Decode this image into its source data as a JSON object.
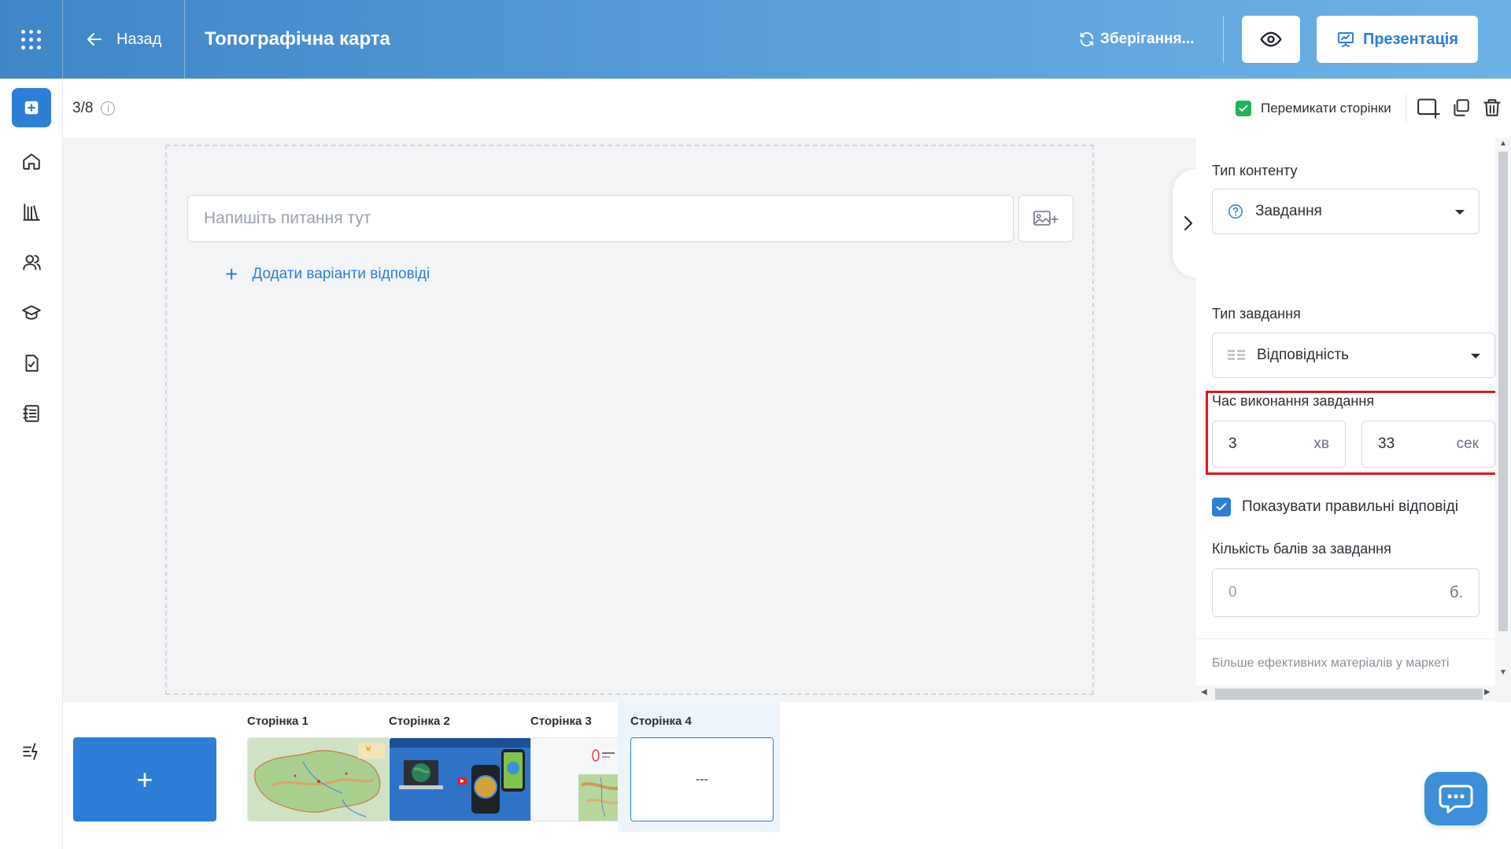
{
  "header": {
    "back_label": "Назад",
    "title": "Топографічна карта",
    "saving_label": "Зберігання...",
    "present_label": "Презентація"
  },
  "subbar": {
    "page_counter": "3/8",
    "switch_pages_label": "Перемикати сторінки",
    "switch_pages_checked": true
  },
  "editor": {
    "question_placeholder": "Напишіть питання тут",
    "question_value": "",
    "add_answers_label": "Додати варіанти відповіді"
  },
  "panel": {
    "content_type_label": "Тип контенту",
    "content_type_value": "Завдання",
    "task_type_label": "Тип завдання",
    "task_type_value": "Відповідність",
    "time_label": "Час виконання завдання",
    "minutes_value": "3",
    "minutes_unit": "хв",
    "seconds_value": "33",
    "seconds_unit": "сек",
    "show_correct_label": "Показувати правильні відповіді",
    "show_correct_checked": true,
    "score_label": "Кількість балів за завдання",
    "score_placeholder": "0",
    "score_unit": "б.",
    "market_link": "Більше ефективних матеріалів у маркеті"
  },
  "pages": {
    "add_label": "+",
    "items": [
      {
        "label": "Сторінка 1"
      },
      {
        "label": "Сторінка 2"
      },
      {
        "label": "Сторінка 3"
      },
      {
        "label": "Сторінка 4",
        "content": "---"
      }
    ],
    "active_index": 3
  },
  "colors": {
    "accent": "#2d7ed6",
    "header_gradient_start": "#3f86c9",
    "header_gradient_end": "#6cb2e6",
    "highlight_frame": "#e3141c",
    "check_green": "#21b35b"
  },
  "icons": {
    "apps": "apps-grid-icon",
    "back": "arrow-left-icon",
    "saving": "refresh-icon",
    "preview": "eye-icon",
    "present": "presentation-icon",
    "chat": "chat-icon"
  }
}
